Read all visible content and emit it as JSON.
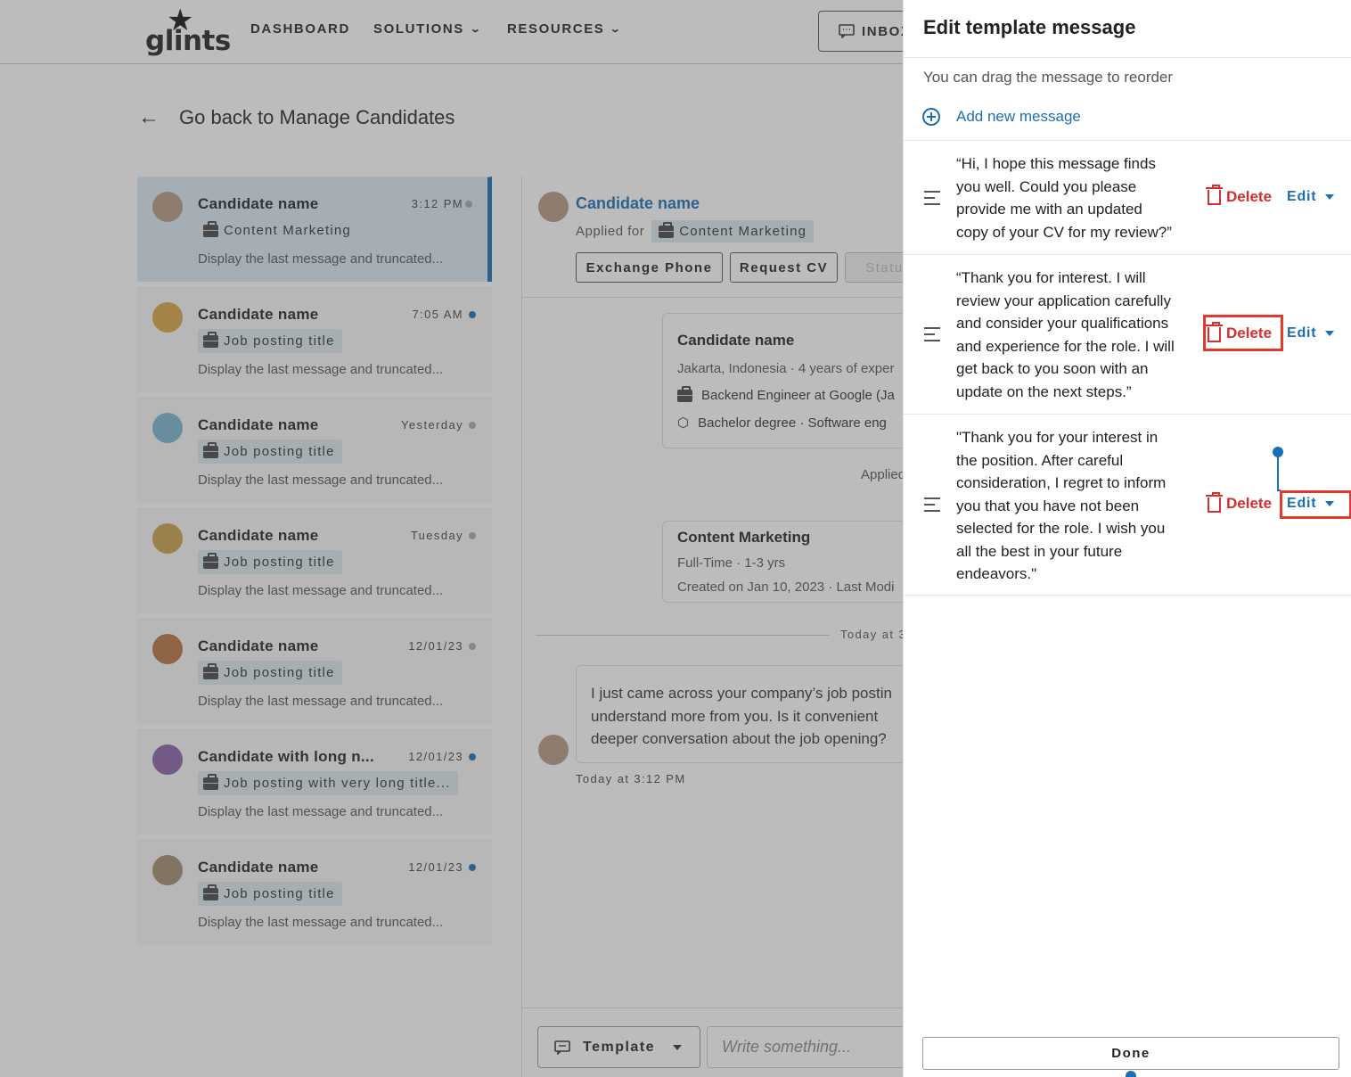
{
  "header": {
    "logo_text": "glints",
    "nav": [
      {
        "label": "DASHBOARD"
      },
      {
        "label": "SOLUTIONS"
      },
      {
        "label": "RESOURCES"
      }
    ],
    "inbox_label": "INBOX"
  },
  "back_label": "Go back to Manage Candidates",
  "candidates": [
    {
      "name": "Candidate name",
      "time": "3:12 PM",
      "job": "Content Marketing",
      "message": "Display the last message and truncated...",
      "unread": false,
      "active": true,
      "avatar_color": "#b59a84"
    },
    {
      "name": "Candidate name",
      "time": "7:05 AM",
      "job": "Job posting title",
      "message": "Display the last message and truncated...",
      "unread": true,
      "active": false,
      "avatar_color": "#d9a441"
    },
    {
      "name": "Candidate name",
      "time": "Yesterday",
      "job": "Job posting title",
      "message": "Display the last message and truncated...",
      "unread": false,
      "active": false,
      "avatar_color": "#7ab3cf"
    },
    {
      "name": "Candidate name",
      "time": "Tuesday",
      "job": "Job posting title",
      "message": "Display the last message and truncated...",
      "unread": false,
      "active": false,
      "avatar_color": "#c8a04a"
    },
    {
      "name": "Candidate name",
      "time": "12/01/23",
      "job": "Job posting title",
      "message": "Display the last message and truncated...",
      "unread": false,
      "active": false,
      "avatar_color": "#b8733f"
    },
    {
      "name": "Candidate with long n...",
      "time": "12/01/23",
      "job": "Job posting with very long title...",
      "message": "Display the last message and truncated...",
      "unread": true,
      "active": false,
      "avatar_color": "#8b5fa8"
    },
    {
      "name": "Candidate name",
      "time": "12/01/23",
      "job": "Job posting title",
      "message": "Display the last message and truncated...",
      "unread": true,
      "active": false,
      "avatar_color": "#a08c6e"
    }
  ],
  "chat": {
    "name": "Candidate name",
    "applied_for_label": "Applied for",
    "applied_job": "Content Marketing",
    "btn_exchange": "Exchange Phone",
    "btn_cv": "Request CV",
    "btn_status": "Status",
    "profile": {
      "name": "Candidate name",
      "location": "Jakarta, Indonesia ·  4 years of exper",
      "work": "Backend Engineer at Google (Ja",
      "edu": "Bachelor degree · Software eng"
    },
    "applied_note": "Applied",
    "job_card": {
      "title": "Content Marketing",
      "meta": "Full-Time · 1-3 yrs",
      "created": "Created on Jan 10, 2023 · Last Modi"
    },
    "divider_label": "Today at 3",
    "message_lines": [
      "I just came across your company’s job postin",
      "understand more from you. Is it convenient",
      "deeper conversation about the job opening?"
    ],
    "message_time": "Today at 3:12 PM",
    "template_label": "Template",
    "input_placeholder": "Write something..."
  },
  "panel": {
    "title": "Edit template message",
    "hint": "You can drag the message to reorder",
    "add_label": "Add new message",
    "delete_label": "Delete",
    "edit_label": "Edit",
    "done_label": "Done",
    "messages": [
      {
        "lines": [
          "“Hi, I hope this message finds",
          "you well. Could you please",
          "provide me with an updated",
          "copy of your CV for my review?”"
        ]
      },
      {
        "lines": [
          "“Thank you for interest. I will",
          "review your application carefully",
          "and consider your qualifications",
          "and experience for the role. I will",
          "get back to you soon with an",
          "update on the next steps.”"
        ]
      },
      {
        "lines": [
          "\"Thank you for your interest in",
          "the position. After careful",
          "consideration, I regret to inform",
          "you that you have not been",
          "selected for the role. I wish you",
          "all the best in your future",
          "endeavors.\""
        ]
      }
    ]
  },
  "colors": {
    "accent": "#1b6fb3",
    "danger": "#d32f2f",
    "highlight": "#e03a2e"
  }
}
